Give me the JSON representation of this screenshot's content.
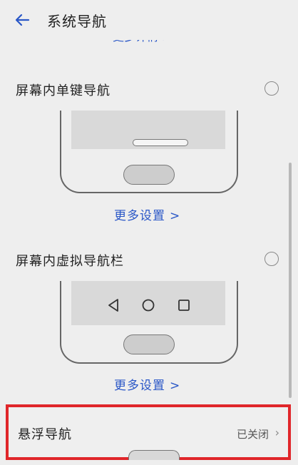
{
  "header": {
    "title": "系统导航",
    "back_icon": "arrow-left-icon"
  },
  "top_cut_link": "更多详情 >",
  "options": [
    {
      "title": "屏幕内单键导航",
      "more_link": "更多设置",
      "selected": false
    },
    {
      "title": "屏幕内虚拟导航栏",
      "more_link": "更多设置",
      "selected": false
    }
  ],
  "floating_nav": {
    "label": "悬浮导航",
    "status": "已关闭"
  },
  "colors": {
    "accent": "#2a57c7",
    "highlight": "#e0262a",
    "background": "#eeeeee"
  }
}
